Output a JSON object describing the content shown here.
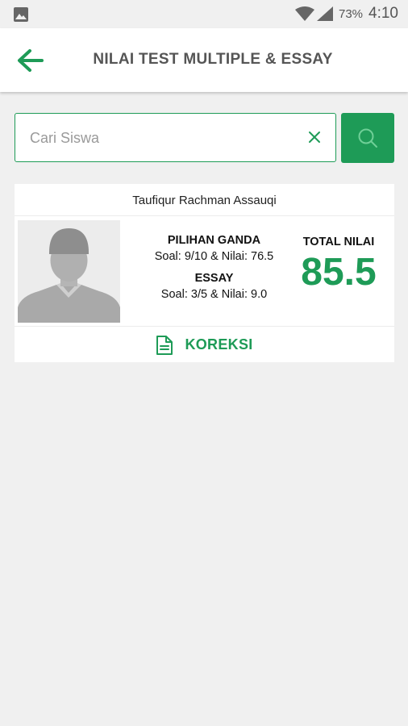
{
  "status_bar": {
    "battery": "73%",
    "time": "4:10",
    "icons": [
      "gallery-icon",
      "wifi-icon",
      "signal-icon"
    ]
  },
  "app_bar": {
    "title": "NILAI TEST MULTIPLE & ESSAY",
    "back_icon": "arrow-left-icon"
  },
  "search": {
    "placeholder": "Cari Siswa",
    "value": "",
    "clear_icon": "close-icon",
    "button_icon": "search-icon"
  },
  "students": [
    {
      "name": "Taufiqur Rachman Assauqi",
      "multiple_choice": {
        "title": "PILIHAN GANDA",
        "detail": "Soal: 9/10 & Nilai: 76.5"
      },
      "essay": {
        "title": "ESSAY",
        "detail": "Soal: 3/5 & Nilai: 9.0"
      },
      "total_label": "TOTAL NILAI",
      "total_value": "85.5",
      "action_label": "KOREKSI",
      "action_icon": "document-icon"
    }
  ],
  "colors": {
    "accent": "#1e9b57",
    "background": "#f0f0f0",
    "card": "#ffffff",
    "title_text": "#555555"
  }
}
